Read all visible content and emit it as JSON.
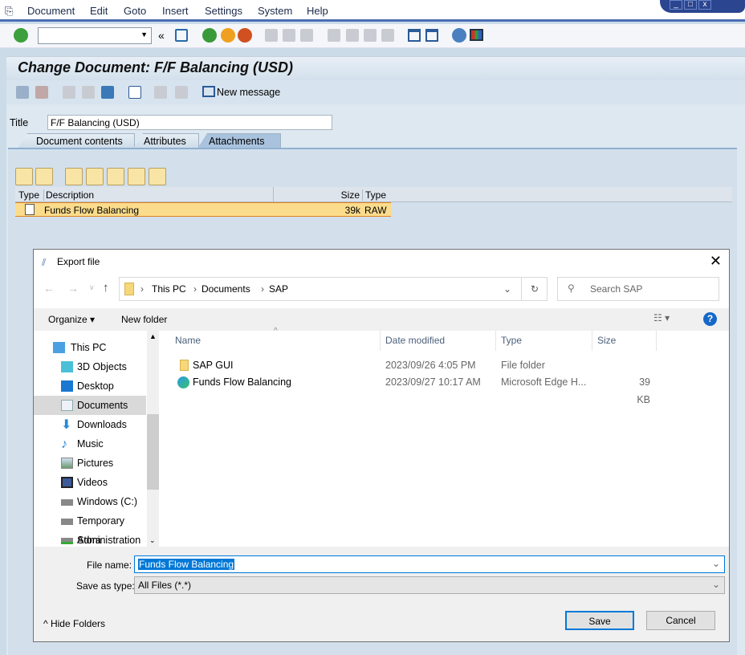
{
  "menu": [
    "Document",
    "Edit",
    "Goto",
    "Insert",
    "Settings",
    "System",
    "Help"
  ],
  "sap": {
    "title": "Change Document: F/F Balancing (USD)",
    "new_message": "New message",
    "title_label": "Title",
    "title_value": "F/F Balancing (USD)",
    "tabs": [
      "Document contents",
      "Attributes",
      "Attachments"
    ],
    "table": {
      "headers": [
        "Type",
        "Description",
        "Size",
        "Type"
      ],
      "rows": [
        {
          "description": "Funds Flow Balancing",
          "size": "39k",
          "type": "RAW"
        }
      ]
    }
  },
  "dialog": {
    "title": "Export file",
    "path": [
      "This PC",
      "Documents",
      "SAP"
    ],
    "search_placeholder": "Search SAP",
    "organize": "Organize",
    "new_folder": "New folder",
    "nav": [
      "This PC",
      "3D Objects",
      "Desktop",
      "Documents",
      "Downloads",
      "Music",
      "Pictures",
      "Videos",
      "Windows (C:)",
      "Temporary Stora",
      "Administration ("
    ],
    "columns": [
      "Name",
      "Date modified",
      "Type",
      "Size"
    ],
    "files": [
      {
        "name": "SAP GUI",
        "date": "2023/09/26 4:05 PM",
        "type": "File folder",
        "size": ""
      },
      {
        "name": "Funds Flow Balancing",
        "date": "2023/09/27 10:17 AM",
        "type": "Microsoft Edge H...",
        "size": "39 KB"
      }
    ],
    "file_name_label": "File name:",
    "file_name": "Funds Flow Balancing",
    "save_type_label": "Save as type:",
    "save_type": "All Files (*.*)",
    "hide_folders": "Hide Folders",
    "save": "Save",
    "cancel": "Cancel"
  }
}
